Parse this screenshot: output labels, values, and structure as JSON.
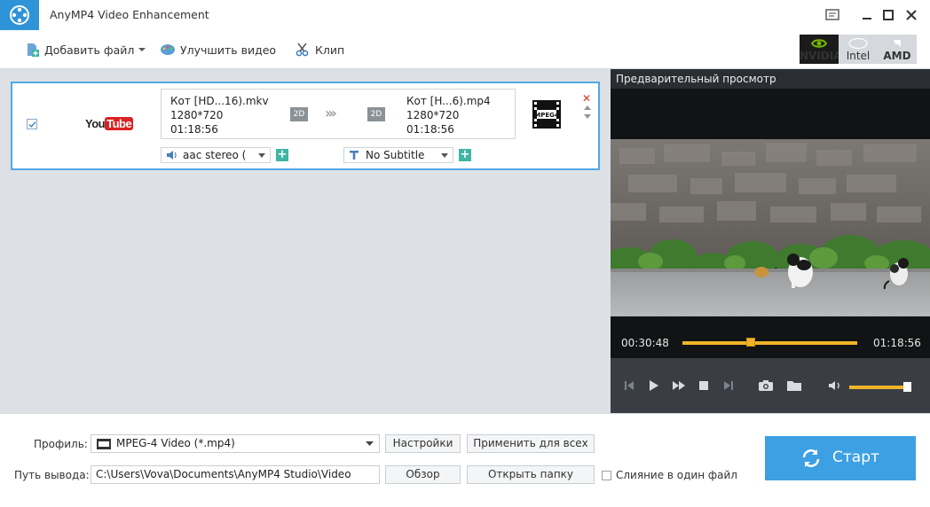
{
  "window": {
    "title": "AnyMP4 Video Enhancement"
  },
  "toolbar": {
    "add_file": "Добавить файл",
    "enhance": "Улучшить видео",
    "clip": "Клип",
    "gpu": [
      {
        "name": "NVIDIA"
      },
      {
        "name": "Intel"
      },
      {
        "name": "AMD"
      }
    ]
  },
  "file_item": {
    "source": {
      "name": "Кот [HD...16).mkv",
      "resolution": "1280*720",
      "duration": "01:18:56",
      "dim": "2D"
    },
    "output": {
      "name": "Кот [H...6).mp4",
      "resolution": "1280*720",
      "duration": "01:18:56",
      "dim": "2D"
    },
    "format_icon": "MPEG4",
    "audio_track": "aac stereo (",
    "subtitle": "No Subtitle"
  },
  "preview": {
    "title": "Предварительный просмотр",
    "current_time": "00:30:48",
    "total_time": "01:18:56",
    "progress": 0.39,
    "volume": 0.93
  },
  "bottom": {
    "profile_label": "Профиль:",
    "profile_value": "MPEG-4 Video (*.mp4)",
    "settings_btn": "Настройки",
    "apply_all_btn": "Применить для всех",
    "output_label": "Путь вывода:",
    "output_path": "C:\\Users\\Vova\\Documents\\AnyMP4 Studio\\Video",
    "browse_btn": "Обзор",
    "open_folder_btn": "Открыть папку",
    "merge_label": "Слияние в один файл",
    "start_btn": "Старт"
  },
  "colors": {
    "accent_blue": "#3da0e3",
    "progress_yellow": "#f0b429",
    "selection_border": "#52a8e5",
    "add_green": "#3fb5a3"
  }
}
